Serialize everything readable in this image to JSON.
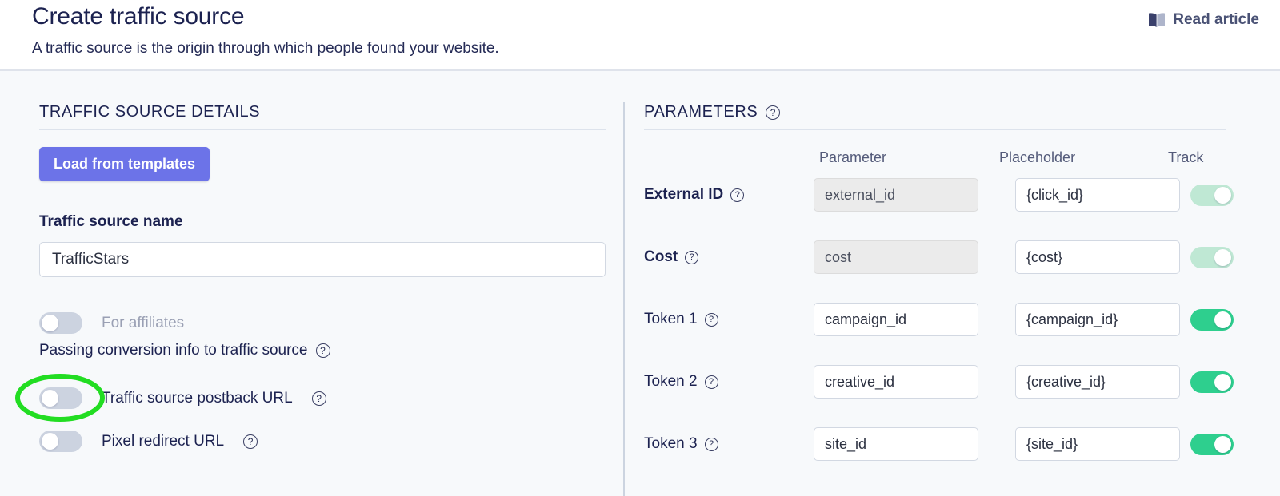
{
  "header": {
    "title": "Create traffic source",
    "subtitle": "A traffic source is the origin through which people found your website.",
    "read_article_label": "Read article",
    "book_icon": "book-icon",
    "book_icon_dark": "#3a406b",
    "book_icon_light": "#aeb5cb"
  },
  "left_panel": {
    "section_title": "TRAFFIC SOURCE DETAILS",
    "load_templates_label": "Load from templates",
    "name_field_label": "Traffic source name",
    "name_field_value": "TrafficStars",
    "name_field_placeholder": "Traffic source name",
    "for_affiliates_label": "For affiliates",
    "for_affiliates_state": "off",
    "passing_conversion_label": "Passing conversion info to traffic source",
    "postback_url_label": "Traffic source postback URL",
    "postback_url_state": "off",
    "pixel_redirect_label": "Pixel redirect URL",
    "pixel_redirect_state": "off",
    "help_icon": "help-circle-icon"
  },
  "right_panel": {
    "section_title": "PARAMETERS",
    "columns": {
      "parameter": "Parameter",
      "placeholder": "Placeholder",
      "track": "Track"
    },
    "rows": [
      {
        "label": "External ID",
        "parameter": "external_id",
        "placeholder": "{click_id}",
        "track": "on",
        "disabled": true,
        "bold": true
      },
      {
        "label": "Cost",
        "parameter": "cost",
        "placeholder": "{cost}",
        "track": "on",
        "disabled": true,
        "bold": true
      },
      {
        "label": "Token 1",
        "parameter": "campaign_id",
        "placeholder": "{campaign_id}",
        "track": "on",
        "disabled": false,
        "bold": false
      },
      {
        "label": "Token 2",
        "parameter": "creative_id",
        "placeholder": "{creative_id}",
        "track": "on",
        "disabled": false,
        "bold": false
      },
      {
        "label": "Token 3",
        "parameter": "site_id",
        "placeholder": "{site_id}",
        "track": "on",
        "disabled": false,
        "bold": false
      }
    ]
  },
  "colors": {
    "accent_button": "#6c73e8",
    "toggle_on": "#2ecf8e",
    "toggle_on_faded": "#bfe8d4",
    "toggle_off": "#ccd3e0",
    "text_dark": "#1c2250",
    "annotation_green": "#22dd22"
  },
  "annotation": {
    "shape": "ellipse-highlight",
    "target": "Traffic source postback URL toggle"
  }
}
